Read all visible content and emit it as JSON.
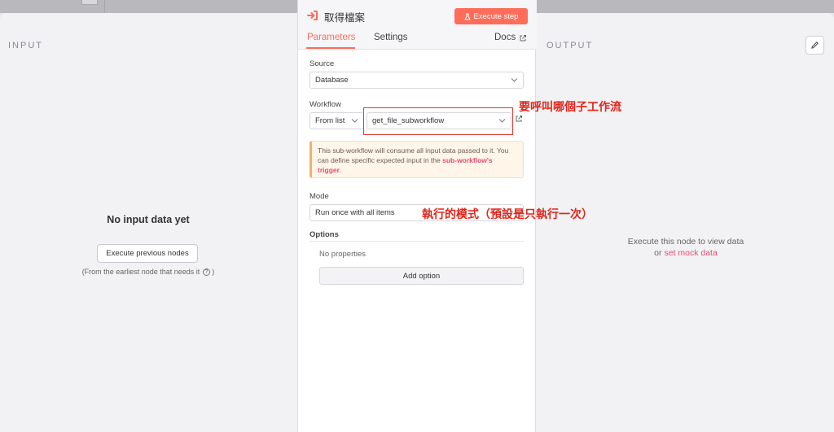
{
  "input_panel": {
    "title": "INPUT",
    "empty_message": "No input data yet",
    "execute_previous_label": "Execute previous nodes",
    "earliest_node_note": "(From the earliest node that needs it",
    "earliest_node_note_end": ")"
  },
  "output_panel": {
    "title": "OUTPUT",
    "message": "Execute this node to view data",
    "or_text": "or",
    "mock_link": "set mock data"
  },
  "node": {
    "title": "取得檔案",
    "execute_step_label": "Execute step",
    "tabs": [
      {
        "label": "Parameters",
        "active": true
      },
      {
        "label": "Settings",
        "active": false
      }
    ],
    "docs_label": "Docs"
  },
  "parameters": {
    "source": {
      "label": "Source",
      "value": "Database"
    },
    "workflow": {
      "label": "Workflow",
      "mode_value": "From list",
      "value": "get_file_subworkflow"
    },
    "notice": {
      "text": "This sub-workflow will consume all input data passed to it. You can define specific expected input in the",
      "link": "sub-workflow's trigger",
      "end": "."
    },
    "mode": {
      "label": "Mode",
      "value": "Run once with all items"
    },
    "options": {
      "label": "Options",
      "empty": "No properties",
      "add_label": "Add option"
    }
  },
  "annotations": {
    "workflow_note": "要呼叫哪個子工作流",
    "mode_note": "執行的模式（預設是只執行一次）"
  },
  "colors": {
    "accent": "#ff6d5a",
    "link": "#ea4b71",
    "annotation": "#e0251b"
  }
}
